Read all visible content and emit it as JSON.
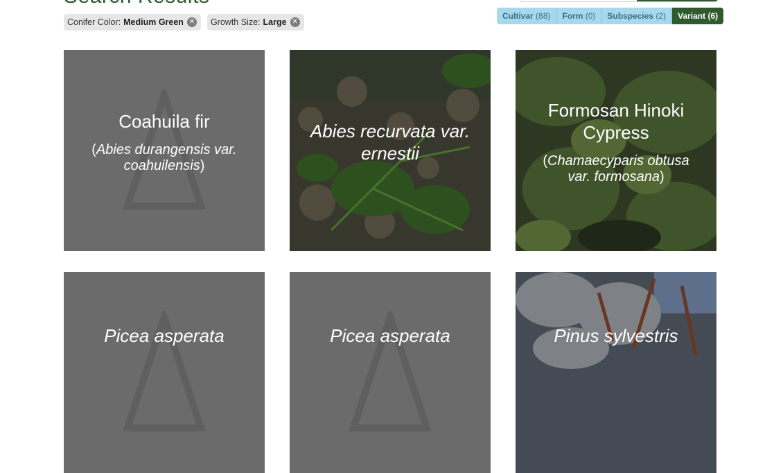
{
  "header": {
    "title": "Search Results"
  },
  "filters": [
    {
      "label": "Conifer Color:",
      "value": "Medium Green"
    },
    {
      "label": "Growth Size:",
      "value": "Large"
    }
  ],
  "type_tabs": [
    {
      "label": "Cultivar",
      "count": "(88)",
      "active": false
    },
    {
      "label": "Form",
      "count": "(0)",
      "active": false
    },
    {
      "label": "Subspecies",
      "count": "(2)",
      "active": false
    },
    {
      "label": "Variant",
      "count": "(6)",
      "active": true
    }
  ],
  "results": [
    {
      "common": "Coahuila fir",
      "sci_open": "(",
      "sci": "Abies durangensis var. coahuilensis",
      "sci_close": ")",
      "image": "placeholder-triangle-icon"
    },
    {
      "common": "",
      "sci_open": "",
      "sci": "Abies recurvata var. ernestii",
      "sci_close": "",
      "image": "photo-ground-foliage"
    },
    {
      "common": "Formosan Hinoki Cypress",
      "sci_open": "(",
      "sci": "Chamaecyparis obtusa var. formosana",
      "sci_close": ")",
      "image": "photo-cypress-foliage"
    },
    {
      "common": "",
      "sci_open": "",
      "sci": "Picea asperata",
      "sci_close": "",
      "image": "placeholder-triangle-icon"
    },
    {
      "common": "",
      "sci_open": "",
      "sci": "Picea asperata",
      "sci_close": "",
      "image": "placeholder-triangle-icon"
    },
    {
      "common": "",
      "sci_open": "",
      "sci": "Pinus sylvestris",
      "sci_close": "",
      "image": "photo-pine-branches"
    }
  ],
  "colors": {
    "brand_green": "#2f5a2e",
    "tab_blue": "#a8d8ec",
    "placeholder_gray": "#6b6b6b"
  }
}
